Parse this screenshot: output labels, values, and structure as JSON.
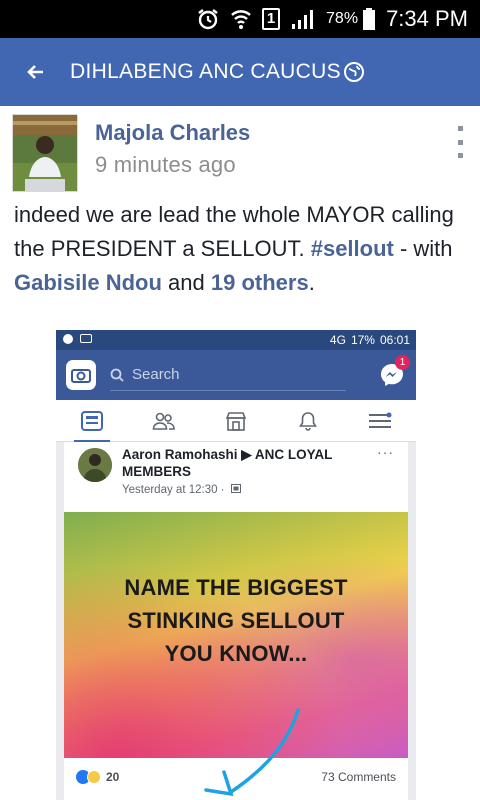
{
  "status_bar": {
    "sim_label": "1",
    "battery": "78%",
    "time": "7:34 PM"
  },
  "app_bar": {
    "title": "DIHLABENG ANC CAUCUS"
  },
  "post": {
    "author": "Majola Charles",
    "time": "9 minutes ago",
    "text_part1": "indeed we are lead the whole MAYOR calling the PRESIDENT a SELLOUT. ",
    "hashtag": "#sellout",
    "text_part2": " - with ",
    "tagged_name": "Gabisile Ndou",
    "text_part3": " and ",
    "others": "19 others",
    "text_end": "."
  },
  "embedded": {
    "status": {
      "network": "4G",
      "battery": "17%",
      "time": "06:01"
    },
    "search_placeholder": "Search",
    "messenger_badge": "1",
    "card": {
      "poster": "Aaron Ramohashi ▶ ANC LOYAL MEMBERS",
      "time": "Yesterday at 12:30 ·",
      "more": "···",
      "image_text": "NAME THE BIGGEST\nSTINKING SELLOUT\nYOU KNOW...",
      "reactions_count": "20",
      "comments": "73 Comments"
    }
  },
  "colors": {
    "facebook_blue": "#4267b2",
    "link_blue": "#4b6496",
    "text_dark": "#1d2129",
    "text_muted": "#8d8d8d"
  }
}
